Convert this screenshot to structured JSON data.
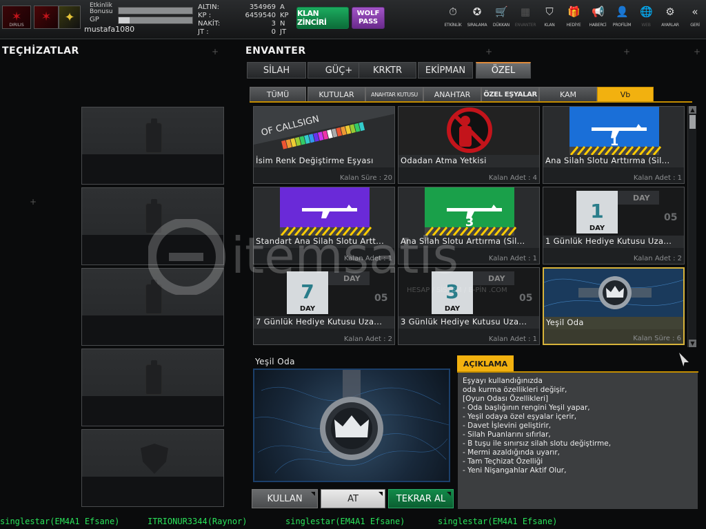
{
  "header": {
    "player_name": "mustafa1080",
    "clan_tag": "DIRILIS",
    "bonus_label": "Etkinlik Bonusu",
    "bonus_progress": 0,
    "gp_label": "GP",
    "gp_progress": 0.15,
    "stats": [
      {
        "label": "ALTIN:",
        "value": "354969",
        "unit": "A"
      },
      {
        "label": "KP :",
        "value": "6459540",
        "unit": "KP"
      },
      {
        "label": "NAKİT:",
        "value": "3",
        "unit": "N"
      },
      {
        "label": "JT :",
        "value": "0",
        "unit": "JT"
      }
    ],
    "chain_button": "KLAN ZİNCİRİ",
    "pass_button": "WOLF PASS",
    "nav": [
      {
        "label": "ETKİNLİK",
        "icon": "stopwatch-icon",
        "glyph": "⏱"
      },
      {
        "label": "SIRALAMA",
        "icon": "medal-icon",
        "glyph": "✪"
      },
      {
        "label": "DÜKKAN",
        "icon": "cart-icon",
        "glyph": "🛒"
      },
      {
        "label": "ENVANTER",
        "icon": "inventory-icon",
        "glyph": "▦",
        "dim": true
      },
      {
        "label": "KLAN",
        "icon": "clan-shield-icon",
        "glyph": "⛉"
      },
      {
        "label": "HEDİYE",
        "icon": "gift-icon",
        "glyph": "🎁"
      },
      {
        "label": "HABERCİ",
        "icon": "megaphone-icon",
        "glyph": "📢"
      },
      {
        "label": "PROFİLİM",
        "icon": "profile-icon",
        "glyph": "👤"
      },
      {
        "label": "WEB",
        "icon": "globe-icon",
        "glyph": "🌐",
        "dim": true
      },
      {
        "label": "AYARLAR",
        "icon": "gear-icon",
        "glyph": "⚙"
      },
      {
        "label": "GERİ",
        "icon": "back-icon",
        "glyph": "«"
      }
    ]
  },
  "equipment": {
    "title": "TEÇHİZATLAR"
  },
  "inventory": {
    "title": "ENVANTER",
    "tabs": [
      "SİLAH",
      "GÜÇ+",
      "KRKTR",
      "EKİPMAN",
      "ÖZEL"
    ],
    "active_tab": 4,
    "subtabs": [
      "TÜMÜ",
      "KUTULAR",
      "ANAHTAR KUTUSU",
      "ANAHTAR",
      "ÖZEL EŞYALAR",
      "KAM",
      "Vb"
    ],
    "active_subtab": 6,
    "items": [
      {
        "name": "İsim Renk Değiştirme Eşyası",
        "remaining": "Kalan Süre : 20",
        "art": "callsign"
      },
      {
        "name": "Odadan Atma Yetkisi",
        "remaining": "Kalan Adet : 4",
        "art": "kick"
      },
      {
        "name": "Ana Silah Slotu Arttırma (Sil...",
        "remaining": "Kalan Adet : 1",
        "art": "slot-blue",
        "number": "1"
      },
      {
        "name": "Standart Ana Silah Slotu Artt...",
        "remaining": "Kalan Adet : 1",
        "art": "slot-purple"
      },
      {
        "name": "Ana Silah Slotu Arttırma (Sil...",
        "remaining": "Kalan Adet : 1",
        "art": "slot-green",
        "number": "3"
      },
      {
        "name": "1 Günlük Hediye Kutusu Uza...",
        "remaining": "Kalan Adet : 2",
        "art": "day",
        "number": "1"
      },
      {
        "name": "7 Günlük Hediye Kutusu Uza...",
        "remaining": "Kalan Adet : 2",
        "art": "day",
        "number": "7"
      },
      {
        "name": "3 Günlük Hediye Kutusu Uza...",
        "remaining": "Kalan Adet : 1",
        "art": "day",
        "number": "3"
      },
      {
        "name": "Yeşil Oda",
        "remaining": "Kalan Süre : 6",
        "art": "crown",
        "selected": true
      }
    ],
    "callsign_text": "OF CALLSIGN",
    "day_text": "DAY",
    "day_side": "05"
  },
  "detail": {
    "title": "Yeşil Oda",
    "description_tab": "AÇIKLAMA",
    "description": [
      "Eşyayı kullandığınızda",
      "oda kurma özellikleri değişir,",
      "[Oyun Odası Özellikleri]",
      "- Oda başlığının rengini Yeşil yapar,",
      "- Yeşil odaya özel eşyalar içerir,",
      "- Davet İşlevini geliştirir,",
      "- Silah Puanlarını sıfırlar,",
      "- B tuşu ile sınırsız silah slotu değiştirme,",
      "- Mermi azaldığında uyarır,",
      "- Tam Teçhizat Özelliği",
      "- Yeni Nişangahlar Aktif Olur,"
    ],
    "buttons": {
      "use": "KULLAN",
      "drop": "AT",
      "renew": "TEKRAR AL"
    }
  },
  "chat": [
    "singlestar(EM4A1 Efsane)",
    "ITRIONUR3344(Raynor)",
    "singlestar(EM4A1 Efsane)",
    "singlestar(EM4A1 Efsane)"
  ],
  "watermark": {
    "text": "itemsatis",
    "subtext": "HESAP / SİSTEM / E-PİN .COM"
  },
  "colors": {
    "accent": "#f2b10f",
    "chat": "#2ae35a",
    "chain": "#1cab5f",
    "pass": "#a255c7"
  }
}
